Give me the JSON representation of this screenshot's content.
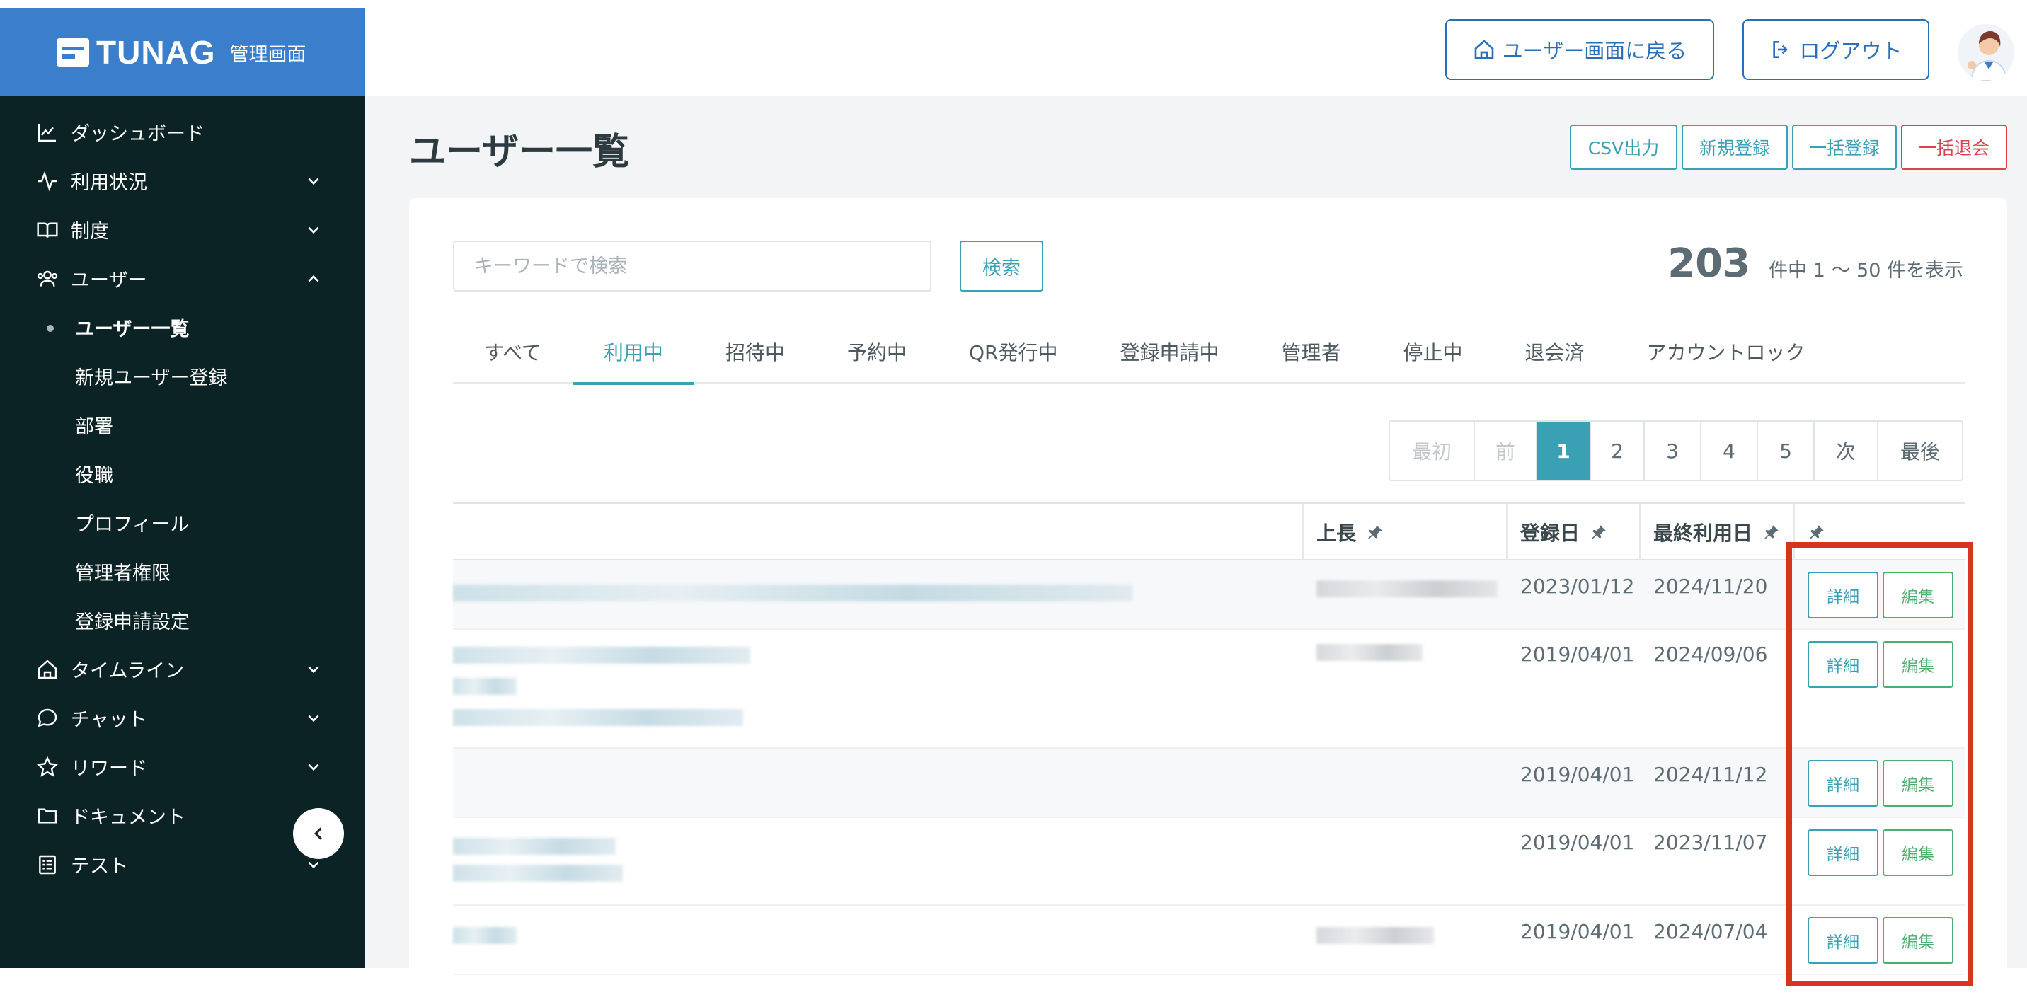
{
  "brand": {
    "name": "TUNAG",
    "sub": "管理画面"
  },
  "sidebar": {
    "items": [
      {
        "label": "ダッシュボード",
        "icon": "chart-line-icon",
        "chevron": ""
      },
      {
        "label": "利用状況",
        "icon": "activity-icon",
        "chevron": "down"
      },
      {
        "label": "制度",
        "icon": "book-icon",
        "chevron": "down"
      },
      {
        "label": "ユーザー",
        "icon": "users-icon",
        "chevron": "up"
      },
      {
        "label": "タイムライン",
        "icon": "home-icon",
        "chevron": "down"
      },
      {
        "label": "チャット",
        "icon": "chat-icon",
        "chevron": "down"
      },
      {
        "label": "リワード",
        "icon": "star-icon",
        "chevron": "down"
      },
      {
        "label": "ドキュメント",
        "icon": "folder-icon",
        "chevron": ""
      },
      {
        "label": "テスト",
        "icon": "checklist-icon",
        "chevron": "down"
      }
    ],
    "subitems": [
      "ユーザー一覧",
      "新規ユーザー登録",
      "部署",
      "役職",
      "プロフィール",
      "管理者権限",
      "登録申請設定"
    ]
  },
  "header": {
    "back_label": "ユーザー画面に戻る",
    "logout_label": "ログアウト"
  },
  "page": {
    "title": "ユーザー一覧",
    "buttons": {
      "csv": "CSV出力",
      "new": "新規登録",
      "bulk_register": "一括登録",
      "bulk_withdraw": "一括退会"
    }
  },
  "search": {
    "placeholder": "キーワードで検索",
    "button": "検索",
    "total": "203",
    "summary": "件中 1 〜 50 件を表示"
  },
  "tabs": [
    "すべて",
    "利用中",
    "招待中",
    "予約中",
    "QR発行中",
    "登録申請中",
    "管理者",
    "停止中",
    "退会済",
    "アカウントロック"
  ],
  "active_tab": "利用中",
  "pagination": [
    "最初",
    "前",
    "1",
    "2",
    "3",
    "4",
    "5",
    "次",
    "最後"
  ],
  "table": {
    "columns": {
      "boss": "上長",
      "registered": "登録日",
      "last_used": "最終利用日"
    },
    "rows": [
      {
        "registered": "2023/01/12",
        "last_used": "2024/11/20",
        "detail": "詳細",
        "edit": "編集"
      },
      {
        "registered": "2019/04/01",
        "last_used": "2024/09/06",
        "detail": "詳細",
        "edit": "編集"
      },
      {
        "registered": "2019/04/01",
        "last_used": "2024/11/12",
        "detail": "詳細",
        "edit": "編集"
      },
      {
        "registered": "2019/04/01",
        "last_used": "2023/11/07",
        "detail": "詳細",
        "edit": "編集"
      },
      {
        "registered": "2019/04/01",
        "last_used": "2024/07/04",
        "detail": "詳細",
        "edit": "編集"
      }
    ]
  },
  "colors": {
    "sidebar_bg": "#0c2325",
    "brand_bg": "#3b7ecb",
    "accent": "#3aa0b3",
    "edit_green": "#4caf6e",
    "danger": "#d9434e",
    "highlight_red": "#d8331f"
  }
}
